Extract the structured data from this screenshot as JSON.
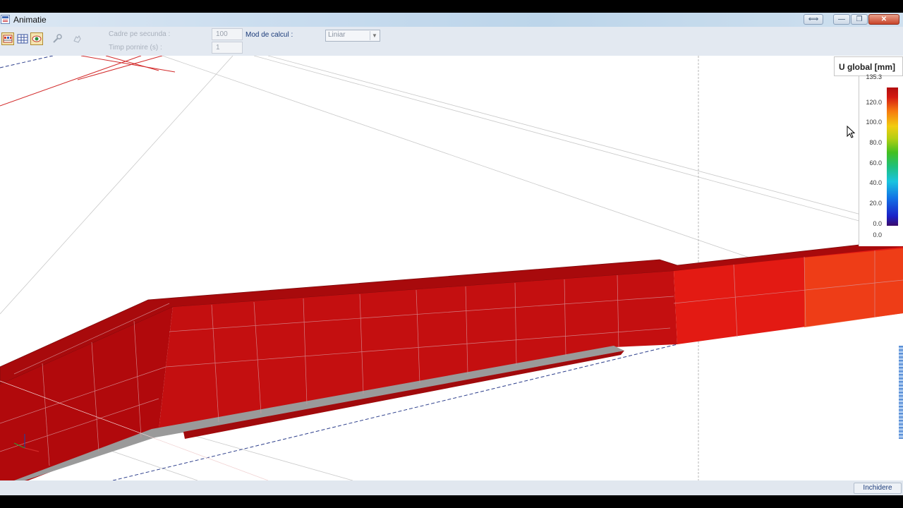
{
  "window": {
    "title": "Animatie",
    "controls": {
      "resize_glyph": "⟺",
      "minimize_glyph": "—",
      "maximize_glyph": "❐",
      "close_glyph": "✕"
    }
  },
  "toolbar": {
    "icons": [
      "film-frames-icon",
      "grid-frames-icon",
      "eye-icon",
      "wrench-icon",
      "hand-icon"
    ],
    "frames_per_second": {
      "label": "Cadre pe secunda :",
      "value": "100"
    },
    "start_time": {
      "label": "Timp pornire (s) :",
      "value": "1"
    },
    "calc_mode": {
      "label": "Mod de calcul :",
      "value": "Liniar"
    }
  },
  "legend": {
    "title": "U global [mm]",
    "max": "135.3",
    "ticks": [
      "120.0",
      "100.0",
      "80.0",
      "60.0",
      "40.0",
      "20.0",
      "0.0"
    ],
    "min": "0.0",
    "colors": [
      "#3c0b6b",
      "#1b22c8",
      "#1272e6",
      "#18c4df",
      "#1fc07a",
      "#43c020",
      "#b3cf12",
      "#f2cc10",
      "#f67a10",
      "#d41a12",
      "#b20e0e"
    ]
  },
  "footer": {
    "close_button": "Inchidere"
  },
  "model": {
    "result": "U global",
    "fill_colors": {
      "dark": "#b5080b",
      "mid": "#d51211",
      "bright": "#ec1f14",
      "end": "#f4531a",
      "rebar": "#9a9a9a"
    }
  }
}
